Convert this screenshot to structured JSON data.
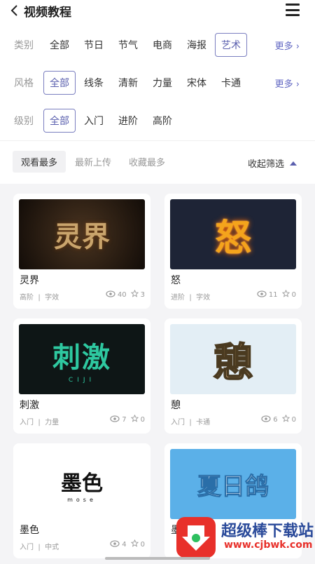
{
  "header": {
    "title": "视频教程"
  },
  "filters": {
    "category": {
      "label": "类别",
      "options": [
        "全部",
        "节日",
        "节气",
        "电商",
        "海报",
        "艺术"
      ],
      "selected": 5,
      "more": "更多 ›"
    },
    "style": {
      "label": "风格",
      "options": [
        "全部",
        "线条",
        "清新",
        "力量",
        "宋体",
        "卡通"
      ],
      "selected": 0,
      "more": "更多 ›"
    },
    "level": {
      "label": "级别",
      "options": [
        "全部",
        "入门",
        "进阶",
        "高阶"
      ],
      "selected": 0
    }
  },
  "sort": {
    "options": [
      "观看最多",
      "最新上传",
      "收藏最多"
    ],
    "selected": 0,
    "collapse_label": "收起筛选"
  },
  "cards": [
    {
      "name": "灵界",
      "level": "高阶",
      "style": "字效",
      "views": "40",
      "favs": "3",
      "thumb_text": "灵界",
      "thumb_bg": "#1a1410",
      "thumb_fg": "#c8a06a"
    },
    {
      "name": "怒",
      "level": "进阶",
      "style": "字效",
      "views": "11",
      "favs": "0",
      "thumb_text": "怒",
      "thumb_bg": "#1e2436",
      "thumb_fg": "#f0a020"
    },
    {
      "name": "刺激",
      "level": "入门",
      "style": "力量",
      "views": "7",
      "favs": "0",
      "thumb_text": "刺激",
      "thumb_sub": "CIJI",
      "thumb_bg": "#101a1a",
      "thumb_fg": "#2ec8a0"
    },
    {
      "name": "憩",
      "level": "入门",
      "style": "卡通",
      "views": "6",
      "favs": "0",
      "thumb_text": "憩",
      "thumb_bg": "#e3eef5",
      "thumb_fg": "#e0b080"
    },
    {
      "name": "墨色",
      "level": "入门",
      "style": "中式",
      "views": "4",
      "favs": "0",
      "thumb_text": "墨色",
      "thumb_sub": "mose",
      "thumb_bg": "#ffffff",
      "thumb_fg": "#111111"
    },
    {
      "name": "墨",
      "level": "",
      "style": "",
      "views": "",
      "favs": "",
      "thumb_text": "夏日鸽",
      "thumb_bg": "#5bb0e8",
      "thumb_fg": "#ffffff"
    }
  ],
  "watermark": {
    "text": "超级棒下载站",
    "url_text": "www.cjbwk.com"
  }
}
